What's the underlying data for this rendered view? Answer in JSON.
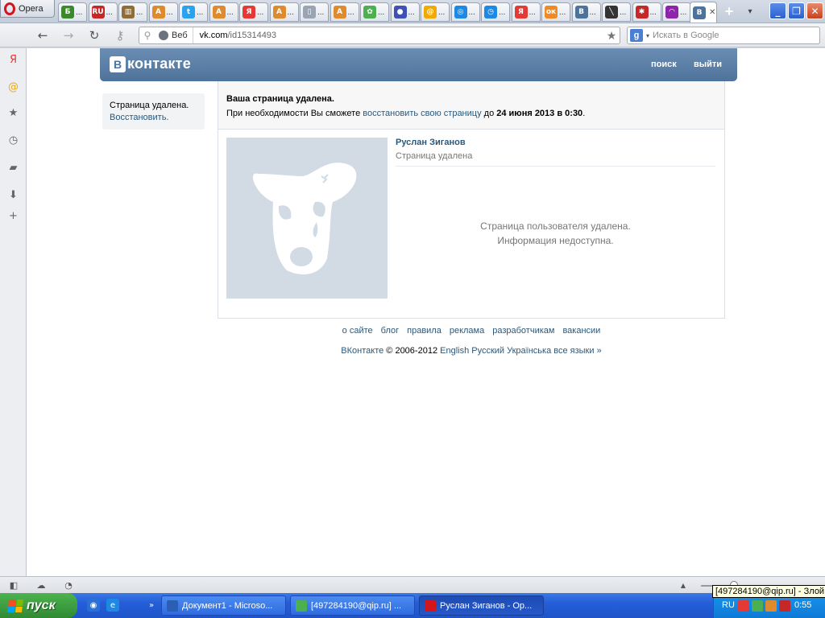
{
  "browser": {
    "menu_label": "Opera",
    "tabs": [
      {
        "name": "tab-b",
        "fav": "Б",
        "color": "#3b8a2a",
        "label": "..."
      },
      {
        "name": "tab-ru",
        "fav": "RU",
        "color": "#c62828",
        "label": "..."
      },
      {
        "name": "tab-books",
        "fav": "▥",
        "color": "#8d6e3a",
        "label": "..."
      },
      {
        "name": "tab-a1",
        "fav": "A",
        "color": "#e08a2e",
        "label": "..."
      },
      {
        "name": "tab-twitter",
        "fav": "t",
        "color": "#2aa3ef",
        "label": "..."
      },
      {
        "name": "tab-a2",
        "fav": "A",
        "color": "#e08a2e",
        "label": "..."
      },
      {
        "name": "tab-ya1",
        "fav": "Я",
        "color": "#e53935",
        "label": "..."
      },
      {
        "name": "tab-a3",
        "fav": "A",
        "color": "#e08a2e",
        "label": "..."
      },
      {
        "name": "tab-doc",
        "fav": "▯",
        "color": "#9aa4b3",
        "label": "..."
      },
      {
        "name": "tab-a4",
        "fav": "A",
        "color": "#e08a2e",
        "label": "..."
      },
      {
        "name": "tab-game",
        "fav": "✿",
        "color": "#4caf50",
        "label": "..."
      },
      {
        "name": "tab-dots",
        "fav": "●",
        "color": "#3f51b5",
        "label": "..."
      },
      {
        "name": "tab-mail",
        "fav": "@",
        "color": "#f2a900",
        "label": "..."
      },
      {
        "name": "tab-globe",
        "fav": "◎",
        "color": "#1e88e5",
        "label": "..."
      },
      {
        "name": "tab-clock",
        "fav": "◷",
        "color": "#1e88e5",
        "label": "..."
      },
      {
        "name": "tab-ya2",
        "fav": "Я",
        "color": "#e53935",
        "label": "..."
      },
      {
        "name": "tab-ok",
        "fav": "ок",
        "color": "#f08a24",
        "label": "..."
      },
      {
        "name": "tab-vk1",
        "fav": "B",
        "color": "#4e739b",
        "label": "..."
      },
      {
        "name": "tab-pen",
        "fav": "╲",
        "color": "#333333",
        "label": "..."
      },
      {
        "name": "tab-bug",
        "fav": "✱",
        "color": "#c62828",
        "label": "..."
      },
      {
        "name": "tab-rainbow",
        "fav": "◠",
        "color": "#8e24aa",
        "label": "..."
      }
    ],
    "active_tab": {
      "fav": "B",
      "color": "#4e739b",
      "close": "✕"
    },
    "new_tab_symbol": "+",
    "new_tab_menu_symbol": "▾",
    "window_controls": {
      "minimize": "_",
      "maximize": "❐",
      "close": "✕"
    },
    "nav": {
      "back": "←",
      "forward": "→",
      "reload": "↻",
      "key": "⚷"
    },
    "address": {
      "pin_symbol": "⚲",
      "web_label": "Веб",
      "url_host": "vk.com",
      "url_path": "/id15314493",
      "bookmark_symbol": "★"
    },
    "search": {
      "engine_letter": "g",
      "caret": "▾",
      "placeholder": "Искать в Google"
    },
    "side_panel_icons": [
      {
        "name": "yandex-icon",
        "glyph": "Я",
        "color": "#e53935"
      },
      {
        "name": "mail-icon",
        "glyph": "@",
        "color": "#f2a900"
      },
      {
        "name": "bookmarks-star-icon",
        "glyph": "★",
        "color": "#666666"
      },
      {
        "name": "history-clock-icon",
        "glyph": "◷",
        "color": "#666666"
      },
      {
        "name": "notes-icon",
        "glyph": "▰",
        "color": "#666666"
      },
      {
        "name": "downloads-icon",
        "glyph": "⬇",
        "color": "#666666"
      },
      {
        "name": "add-panel-icon",
        "glyph": "+",
        "color": "#666666"
      }
    ],
    "status_icons": {
      "panel_toggle": "◧",
      "cloud": "☁",
      "speed": "◔",
      "zoom_up": "▲"
    }
  },
  "vk": {
    "brand_letter": "B",
    "brand_word": "контакте",
    "nav_search": "поиск",
    "nav_logout": "выйти",
    "side_notice": {
      "text": "Страница удалена.",
      "link": "Восстановить."
    },
    "banner": {
      "title": "Ваша страница удалена.",
      "msg_before": "При необходимости Вы сможете ",
      "msg_link": "восстановить свою страницу",
      "msg_mid": " до ",
      "msg_date": "24 июня 2013 в 0:30",
      "msg_end": "."
    },
    "profile": {
      "name": "Руслан Зиганов",
      "status": "Страница удалена",
      "deleted_line1": "Страница пользователя удалена.",
      "deleted_line2": "Информация недоступна."
    },
    "footer_links": [
      "о сайте",
      "блог",
      "правила",
      "реклама",
      "разработчикам",
      "вакансии"
    ],
    "footer_copy_brand": "ВКонтакте",
    "footer_copy_years": " © 2006-2012 ",
    "footer_languages": "English Русский Українська все языки »"
  },
  "taskbar": {
    "start_label": "пуск",
    "quick_launch": [
      {
        "name": "show-desktop-icon",
        "glyph": "◉",
        "color": "#2b6fd6"
      },
      {
        "name": "ie-icon",
        "glyph": "e",
        "color": "#1e88e5"
      },
      {
        "name": "quicklaunch-more-icon",
        "glyph": "»",
        "color": "transparent"
      }
    ],
    "tasks": [
      {
        "label": "Документ1 - Microsо...",
        "icon_color": "#2b5fb6",
        "active": false
      },
      {
        "label": "[497284190@qip.ru] ...",
        "icon_color": "#4caf50",
        "active": false
      },
      {
        "label": "Руслан Зиганов - Op...",
        "icon_color": "#d1161d",
        "active": true
      }
    ],
    "tray": {
      "lang": "RU",
      "time": "0:55",
      "icons": [
        "#e53935",
        "#4caf50",
        "#e08a2e",
        "#c62828"
      ]
    },
    "tooltip": "[497284190@qip.ru] - Злой"
  }
}
